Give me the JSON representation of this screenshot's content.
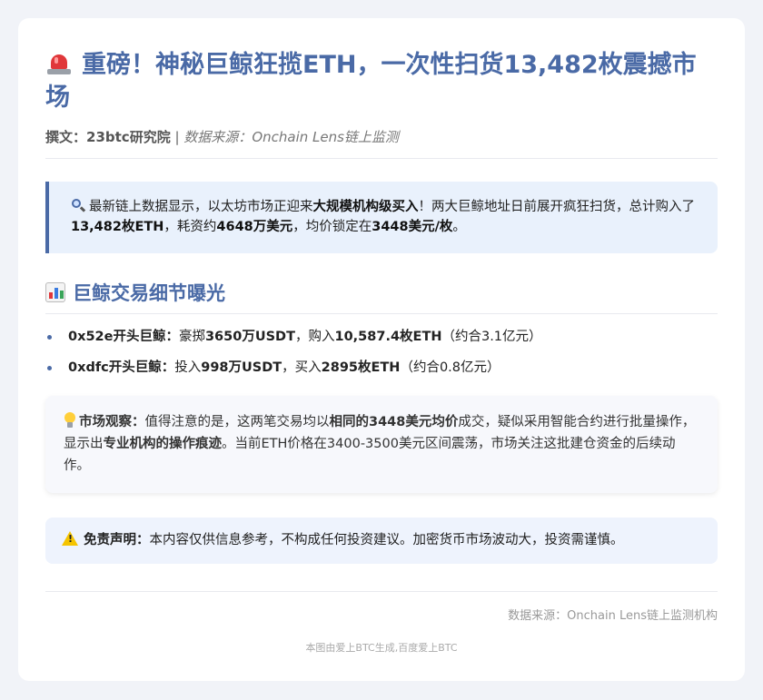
{
  "article": {
    "title": "重磅！神秘巨鲸狂揽ETH，一次性扫货13,482枚震撼市场",
    "title_icon": "siren-icon",
    "author_label": "撰文：",
    "author": "23btc研究院",
    "meta_separator": " | ",
    "source_label": "数据来源：",
    "source": "Onchain Lens链上监测"
  },
  "intro": {
    "icon": "magnifier-icon",
    "parts": [
      {
        "text": "最新链上数据显示，以太坊市场正迎来",
        "bold": false
      },
      {
        "text": "大规模机构级买入",
        "bold": true
      },
      {
        "text": "！两大巨鲸地址日前展开疯狂扫货，总计购入了",
        "bold": false
      },
      {
        "text": "13,482枚ETH",
        "bold": true
      },
      {
        "text": "，耗资约",
        "bold": false
      },
      {
        "text": "4648万美元",
        "bold": true
      },
      {
        "text": "，均价锁定在",
        "bold": false
      },
      {
        "text": "3448美元/枚",
        "bold": true
      },
      {
        "text": "。",
        "bold": false
      }
    ]
  },
  "section": {
    "icon": "bar-chart-icon",
    "heading": "巨鲸交易细节曝光",
    "items": [
      {
        "parts": [
          {
            "text": "0x52e开头巨鲸：",
            "bold": true
          },
          {
            "text": "豪掷",
            "bold": false
          },
          {
            "text": "3650万USDT",
            "bold": true
          },
          {
            "text": "，购入",
            "bold": false
          },
          {
            "text": "10,587.4枚ETH",
            "bold": true
          },
          {
            "text": "（约合3.1亿元）",
            "bold": false
          }
        ]
      },
      {
        "parts": [
          {
            "text": "0xdfc开头巨鲸：",
            "bold": true
          },
          {
            "text": "投入",
            "bold": false
          },
          {
            "text": "998万USDT",
            "bold": true
          },
          {
            "text": "，买入",
            "bold": false
          },
          {
            "text": "2895枚ETH",
            "bold": true
          },
          {
            "text": "（约合0.8亿元）",
            "bold": false
          }
        ]
      }
    ]
  },
  "insight": {
    "icon": "lightbulb-icon",
    "parts": [
      {
        "text": "市场观察：",
        "bold": true
      },
      {
        "text": "值得注意的是，这两笔交易均以",
        "bold": false
      },
      {
        "text": "相同的3448美元均价",
        "bold": true
      },
      {
        "text": "成交，疑似采用智能合约进行批量操作，显示出",
        "bold": false
      },
      {
        "text": "专业机构的操作痕迹",
        "bold": true
      },
      {
        "text": "。当前ETH价格在3400-3500美元区间震荡，市场关注这批建仓资金的后续动作。",
        "bold": false
      }
    ]
  },
  "disclaimer": {
    "icon": "warning-icon",
    "parts": [
      {
        "text": "免责声明：",
        "bold": true
      },
      {
        "text": "本内容仅供信息参考，不构成任何投资建议。加密货币市场波动大，投资需谨慎。",
        "bold": false
      }
    ]
  },
  "footer": {
    "source": "数据来源：Onchain Lens链上监测机构",
    "watermark": "本图由爱上BTC生成,百度爱上BTC"
  },
  "colors": {
    "accent": "#4a6aa6",
    "intro_bg": "#e9f1fc",
    "disclaimer_bg": "#eef3fd"
  }
}
